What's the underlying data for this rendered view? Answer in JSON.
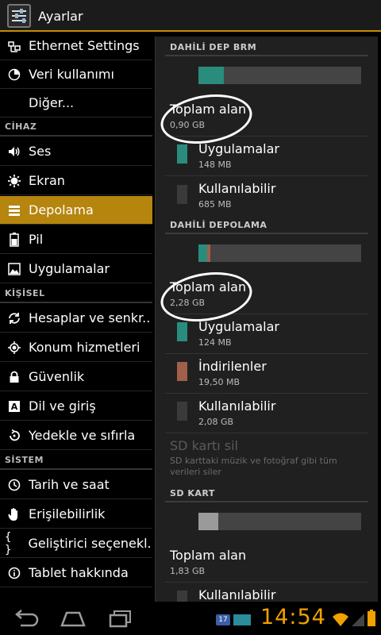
{
  "action_bar": {
    "title": "Ayarlar"
  },
  "left_menu": {
    "items_top": [
      {
        "label": "Ethernet Settings",
        "icon": "ethernet-icon"
      },
      {
        "label": "Veri kullanımı",
        "icon": "data-usage-icon"
      },
      {
        "label": "Diğer...",
        "icon": ""
      }
    ],
    "section_device": "CİHAZ",
    "items_device": [
      {
        "label": "Ses",
        "icon": "sound-icon"
      },
      {
        "label": "Ekran",
        "icon": "display-icon"
      },
      {
        "label": "Depolama",
        "icon": "storage-icon"
      },
      {
        "label": "Pil",
        "icon": "battery-icon"
      },
      {
        "label": "Uygulamalar",
        "icon": "apps-icon"
      }
    ],
    "section_personal": "KİŞİSEL",
    "items_personal": [
      {
        "label": "Hesaplar ve senkr..",
        "icon": "sync-icon"
      },
      {
        "label": "Konum hizmetleri",
        "icon": "location-icon"
      },
      {
        "label": "Güvenlik",
        "icon": "lock-icon"
      },
      {
        "label": "Dil ve giriş",
        "icon": "language-icon"
      },
      {
        "label": "Yedekle ve sıfırla",
        "icon": "backup-icon"
      }
    ],
    "section_system": "SİSTEM",
    "items_system": [
      {
        "label": "Tarih ve saat",
        "icon": "clock-icon"
      },
      {
        "label": "Erişilebilirlik",
        "icon": "hand-icon"
      },
      {
        "label": "Geliştirici seçenekl..",
        "icon": "braces-icon"
      },
      {
        "label": "Tablet hakkında",
        "icon": "info-icon"
      }
    ],
    "selected": "Depolama"
  },
  "storage": {
    "internal_brm": {
      "header": "DAHİLİ DEP BRM",
      "total_label": "Toplam alan",
      "total_value": "0,90 GB",
      "apps_label": "Uygulamalar",
      "apps_value": "148 MB",
      "avail_label": "Kullanılabilir",
      "avail_value": "685 MB",
      "usage_fraction_apps": 0.16
    },
    "internal": {
      "header": "DAHİLİ DEPOLAMA",
      "total_label": "Toplam alan",
      "total_value": "2,28 GB",
      "apps_label": "Uygulamalar",
      "apps_value": "124 MB",
      "downloads_label": "İndirilenler",
      "downloads_value": "19,50 MB",
      "avail_label": "Kullanılabilir",
      "avail_value": "2,08 GB",
      "usage_fraction_apps": 0.05,
      "usage_fraction_downloads": 0.02
    },
    "sd_erase": {
      "title": "SD kartı sil",
      "desc_line1": "SD karttaki müzik ve fotoğraf gibi tüm",
      "desc_line2": "verileri siler"
    },
    "sd_card": {
      "header": "SD KART",
      "total_label": "Toplam alan",
      "total_value": "1,83 GB",
      "avail_label": "Kullanılabilir",
      "usage_fraction_used": 0.12
    }
  },
  "status_bar": {
    "time": "14:54",
    "notification_count": "17"
  },
  "colors": {
    "accent": "#b5850e",
    "apps": "#2a8c7c",
    "downloads": "#a0604a",
    "available": "#3a3a3a",
    "sd_used": "#9a9a9a"
  }
}
